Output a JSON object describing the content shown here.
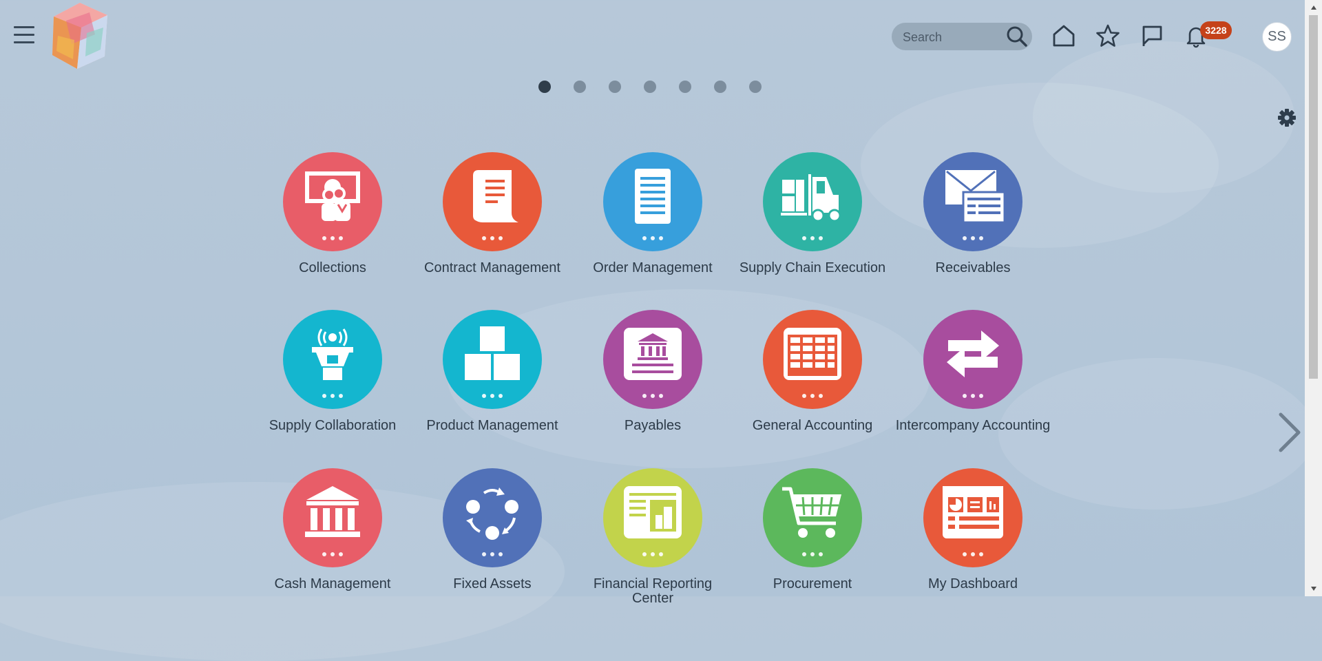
{
  "header": {
    "menu_icon": "hamburger-menu-icon",
    "logo_icon": "app-logo-icon",
    "search": {
      "placeholder": "Search",
      "value": ""
    },
    "icons": [
      "search-icon",
      "home-icon",
      "favorites-star-icon",
      "watchlist-flag-icon",
      "notifications-bell-icon"
    ],
    "notification_count": "3228",
    "user_initials": "SS"
  },
  "pager": {
    "page_count": 7,
    "active_index": 0
  },
  "settings_icon": "gear-icon",
  "next_page_icon": "chevron-right-icon",
  "tiles": [
    {
      "label": "Collections",
      "color": "#e85d68",
      "icon": "collections-icon"
    },
    {
      "label": "Contract Management",
      "color": "#e8593a",
      "icon": "contract-scroll-icon"
    },
    {
      "label": "Order Management",
      "color": "#379fdc",
      "icon": "order-document-icon"
    },
    {
      "label": "Supply Chain Execution",
      "color": "#2eb3a4",
      "icon": "forklift-icon"
    },
    {
      "label": "Receivables",
      "color": "#5171b8",
      "icon": "invoice-envelope-icon"
    },
    {
      "label": "Supply Collaboration",
      "color": "#14b6cf",
      "icon": "broadcast-tower-icon"
    },
    {
      "label": "Product Management",
      "color": "#14b6cf",
      "icon": "stacked-boxes-icon"
    },
    {
      "label": "Payables",
      "color": "#a84d9e",
      "icon": "bank-document-icon"
    },
    {
      "label": "General Accounting",
      "color": "#e8593a",
      "icon": "ledger-grid-icon"
    },
    {
      "label": "Intercompany Accounting",
      "color": "#a84d9e",
      "icon": "transfer-arrows-icon"
    },
    {
      "label": "Cash Management",
      "color": "#e85d68",
      "icon": "bank-building-icon"
    },
    {
      "label": "Fixed Assets",
      "color": "#5171b8",
      "icon": "cycle-nodes-icon"
    },
    {
      "label": "Financial Reporting Center",
      "color": "#c2d34b",
      "icon": "report-chart-icon"
    },
    {
      "label": "Procurement",
      "color": "#5cb85c",
      "icon": "shopping-cart-icon"
    },
    {
      "label": "My Dashboard",
      "color": "#e8593a",
      "icon": "dashboard-icon"
    }
  ]
}
